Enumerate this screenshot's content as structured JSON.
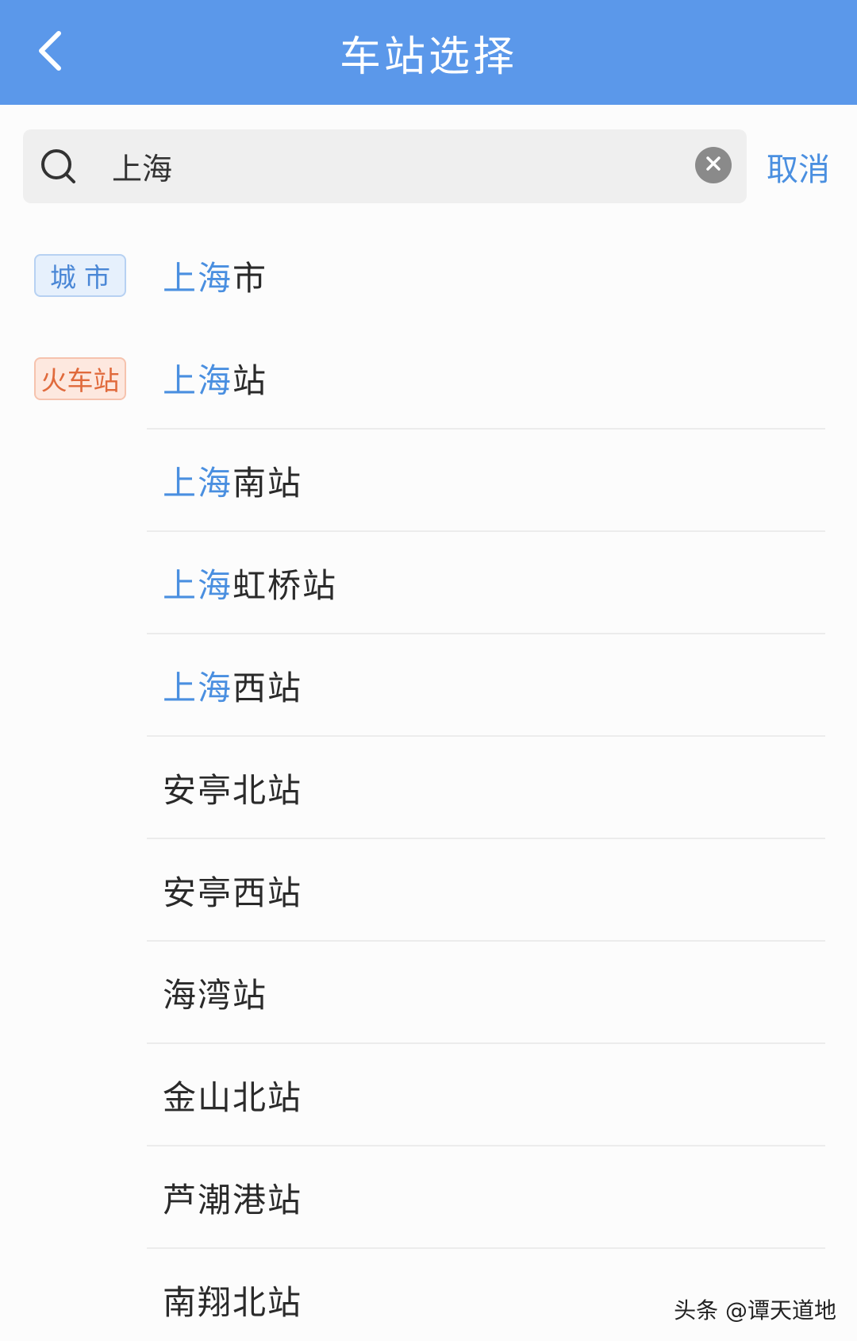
{
  "header": {
    "title": "车站选择",
    "back_icon": "chevron-left-icon"
  },
  "search": {
    "value": "上海",
    "icon": "search-icon",
    "clear_icon": "clear-icon",
    "cancel_label": "取消"
  },
  "results": [
    {
      "tag": "城市",
      "highlight": "上海",
      "rest": "市"
    },
    {
      "tag": "火车站",
      "highlight": "上海",
      "rest": "站"
    },
    {
      "tag": "",
      "highlight": "上海",
      "rest": "南站"
    },
    {
      "tag": "",
      "highlight": "上海",
      "rest": "虹桥站"
    },
    {
      "tag": "",
      "highlight": "上海",
      "rest": "西站"
    },
    {
      "tag": "",
      "highlight": "",
      "rest": "安亭北站"
    },
    {
      "tag": "",
      "highlight": "",
      "rest": "安亭西站"
    },
    {
      "tag": "",
      "highlight": "",
      "rest": "海湾站"
    },
    {
      "tag": "",
      "highlight": "",
      "rest": "金山北站"
    },
    {
      "tag": "",
      "highlight": "",
      "rest": "芦潮港站"
    },
    {
      "tag": "",
      "highlight": "",
      "rest": "南翔北站"
    }
  ],
  "watermark": "头条 @谭天道地",
  "colors": {
    "header_bg": "#5b98ea",
    "accent": "#4a8fe0",
    "city_tag": "#4a87d6",
    "train_tag": "#e06a3c"
  }
}
